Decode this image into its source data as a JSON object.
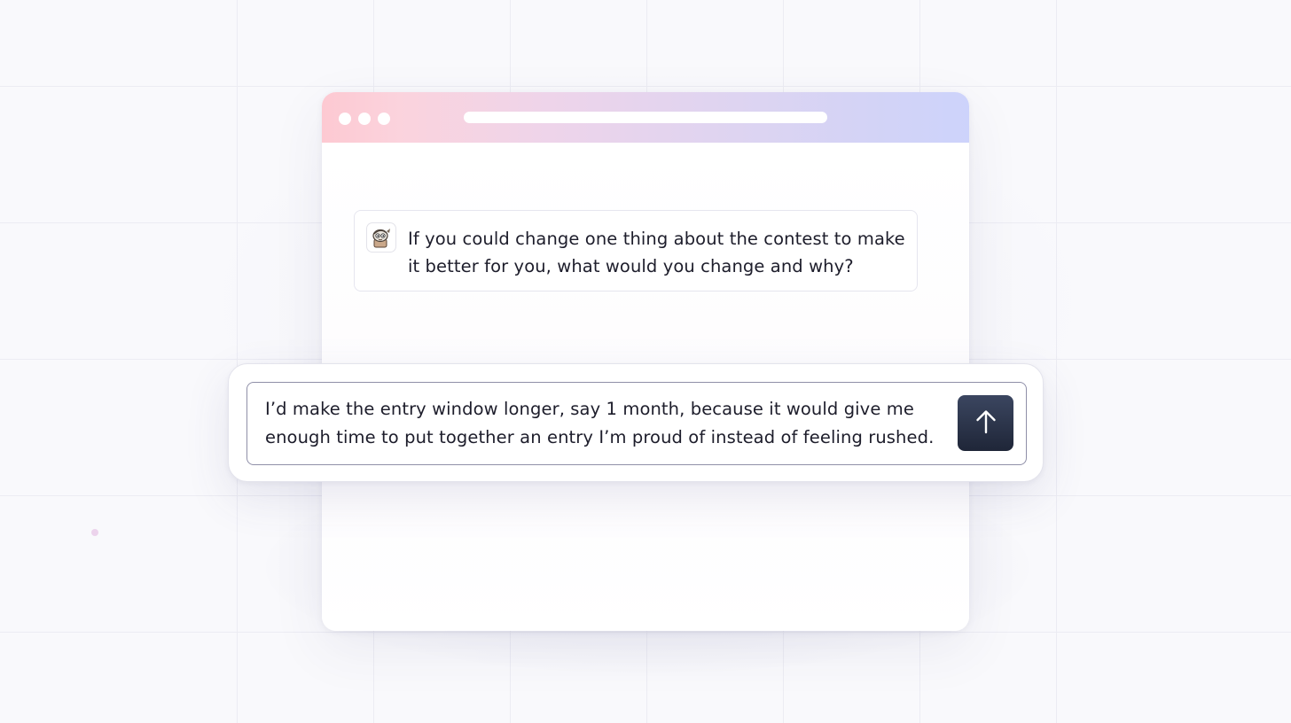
{
  "window": {
    "traffic_lights": [
      "dot",
      "dot",
      "dot"
    ],
    "titlebar_colors": [
      "#fdc9d2",
      "#cdd3fb"
    ]
  },
  "question": {
    "avatar_icon": "cartoon-character-icon",
    "text": "If you could change one thing about the contest to make it better for you, what would you change and why?"
  },
  "composer": {
    "answer_text": "I’d make the entry window longer, say 1 month, because it would give me enough time to put together an entry I’m proud of instead of feeling rushed.",
    "send_icon": "arrow-up-icon"
  },
  "colors": {
    "send_button": "#262e42",
    "background": "#f9f9fc"
  }
}
